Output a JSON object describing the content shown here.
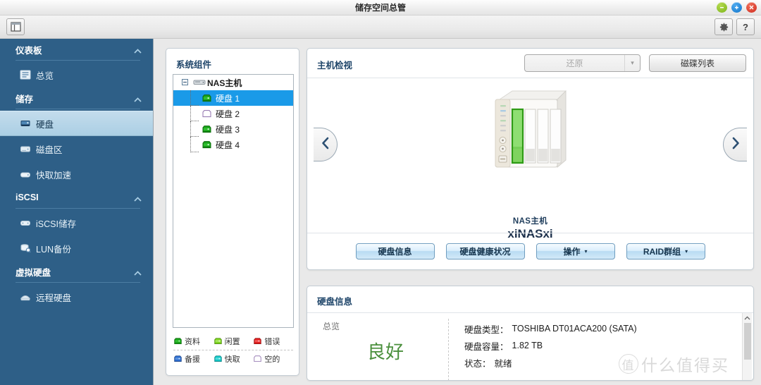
{
  "window": {
    "title": "储存空间总管",
    "minimize_label": "−",
    "maximize_label": "+",
    "close_label": "×"
  },
  "toolbar": {
    "panel_toggle_icon": "panel-layout-icon",
    "settings_icon": "gear-icon",
    "help_label": "?"
  },
  "sidebar": {
    "groups": [
      {
        "label": "仪表板",
        "chevron": "⌃",
        "items": [
          {
            "label": "总览",
            "icon": "overview-icon",
            "active": false
          }
        ]
      },
      {
        "label": "储存",
        "chevron": "⌃",
        "items": [
          {
            "label": "硬盘",
            "icon": "harddisk-icon",
            "active": true
          },
          {
            "label": "磁盘区",
            "icon": "volume-icon",
            "active": false
          },
          {
            "label": "快取加速",
            "icon": "cache-icon",
            "active": false
          }
        ]
      },
      {
        "label": "iSCSI",
        "chevron": "⌃",
        "items": [
          {
            "label": "iSCSI储存",
            "icon": "iscsi-storage-icon",
            "active": false
          },
          {
            "label": "LUN备份",
            "icon": "lun-backup-icon",
            "active": false
          }
        ]
      },
      {
        "label": "虚拟硬盘",
        "chevron": "⌃",
        "items": [
          {
            "label": "远程硬盘",
            "icon": "remote-disk-icon",
            "active": false
          }
        ]
      }
    ]
  },
  "tree_panel": {
    "title": "系统组件",
    "root": {
      "label": "NAS主机",
      "icon": "nas-host-icon",
      "expanded": true,
      "toggle": "−"
    },
    "children": [
      {
        "label": "硬盘 1",
        "icon": "disk-green-icon",
        "state": "data",
        "selected": true
      },
      {
        "label": "硬盘 2",
        "icon": "disk-empty-icon",
        "state": "empty",
        "selected": false
      },
      {
        "label": "硬盘 3",
        "icon": "disk-green-icon",
        "state": "data",
        "selected": false
      },
      {
        "label": "硬盘 4",
        "icon": "disk-green-icon",
        "state": "data",
        "selected": false
      }
    ],
    "legend": [
      {
        "label": "资料",
        "color": "#1aa11a",
        "icon": "disk-green-icon"
      },
      {
        "label": "闲置",
        "color": "#7ed321",
        "icon": "disk-lightgreen-icon"
      },
      {
        "label": "错误",
        "color": "#e02020",
        "icon": "disk-red-icon"
      },
      {
        "label": "备援",
        "color": "#2f6fd0",
        "icon": "disk-blue-icon"
      },
      {
        "label": "快取",
        "color": "#16c6c6",
        "icon": "disk-cyan-icon"
      },
      {
        "label": "空的",
        "color": "#ffffff",
        "icon": "disk-empty-icon"
      }
    ]
  },
  "host_panel": {
    "title": "主机检视",
    "restore_button": {
      "label": "还原",
      "disabled": true,
      "caret": "▾"
    },
    "disklist_button": {
      "label": "磁碟列表"
    },
    "nav_prev_icon": "chevron-left-icon",
    "nav_next_icon": "chevron-right-icon",
    "device": {
      "caption_line1": "NAS主机",
      "caption_line2": "xiNASxi",
      "bays": 4,
      "selected_bay": 1,
      "selected_bay_color": "#5fc44a"
    },
    "actions": [
      {
        "label": "硬盘信息",
        "has_caret": false
      },
      {
        "label": "硬盘健康状况",
        "has_caret": false
      },
      {
        "label": "操作",
        "has_caret": true,
        "caret": "▾"
      },
      {
        "label": "RAID群组",
        "has_caret": true,
        "caret": "▾"
      }
    ]
  },
  "disk_info": {
    "title": "硬盘信息",
    "overview_label": "总览",
    "overview_status": "良好",
    "overview_status_color": "#4a8f3c",
    "rows": [
      {
        "key": "硬盘类型：",
        "value": "TOSHIBA DT01ACA200 (SATA)"
      },
      {
        "key": "硬盘容量：",
        "value": "1.82 TB"
      },
      {
        "key": "状态：",
        "value": "就绪"
      }
    ],
    "scroll_up_icon": "chevron-up-icon"
  },
  "watermark": {
    "mark": "值",
    "text": "什么值得买"
  }
}
